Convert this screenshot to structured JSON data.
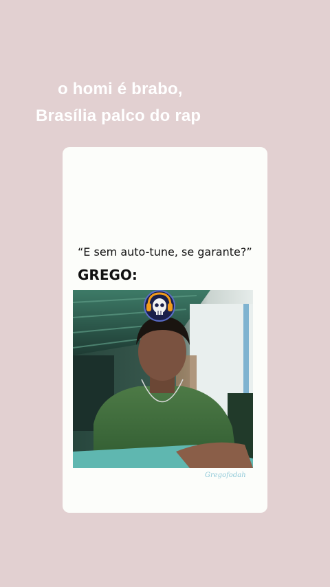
{
  "caption": {
    "line1": "o homi é brabo,",
    "line2": "Brasília palco do rap"
  },
  "meme": {
    "quote": "“E sem auto-tune, se garante?”",
    "subject": "GREGO:",
    "watermark": "Gregofodah",
    "badge_icon": "skull-headphones-icon"
  },
  "colors": {
    "background": "#e2d0d1",
    "card": "#fcfdfa",
    "caption_text": "#ffffff"
  }
}
